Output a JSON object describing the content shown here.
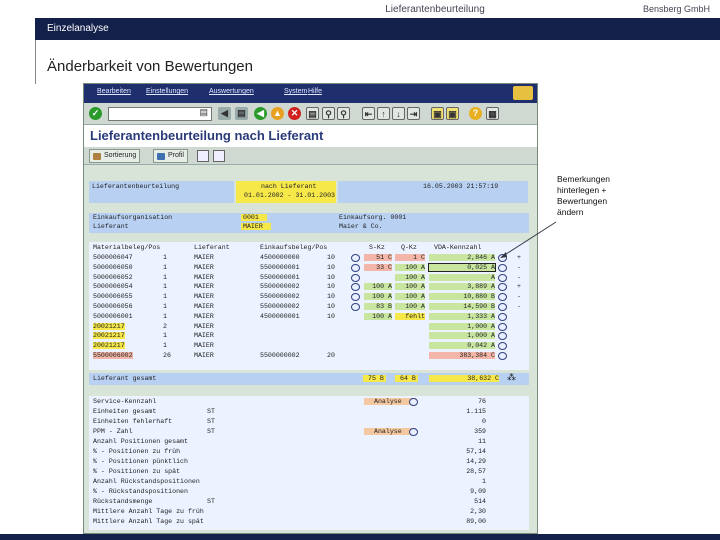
{
  "header": {
    "title": "Lieferantenbeurteilung",
    "company": "Bensberg GmbH",
    "section": "Einzelanalyse"
  },
  "slide_title": "Änderbarkeit von Bewertungen",
  "annotation": [
    "Bemerkungen",
    "hinterlegen +",
    "Bewertungen",
    "ändern"
  ],
  "sap": {
    "menu": [
      "Bearbeiten",
      "Einstellungen",
      "Auswertungen",
      "System",
      "Hilfe"
    ],
    "command_field_value": "",
    "title": "Lieferantenbeurteilung nach Lieferant",
    "app_buttons": [
      "Sortierung",
      "Profil"
    ],
    "info": {
      "label": "Lieferantenbeurteilung",
      "mode": "nach Lieferant",
      "period": "01.01.2002 - 31.01.2003",
      "timestamp": "16.05.2003 21:57:19"
    },
    "org": {
      "ek_org_label": "Einkaufsorganisation",
      "ek_org_value": "0001",
      "ek_org_text": "Einkaufsorg. 0001",
      "lieferant_label": "Lieferant",
      "lieferant_value": "MAIER",
      "lieferant_text": "Maier & Co."
    },
    "table": {
      "columns": [
        "Materialbeleg/Pos",
        "Lieferant",
        "Einkaufsbeleg/Pos",
        "S-Kz",
        "Q-Kz",
        "VDA-Kennzahl"
      ],
      "rows": [
        {
          "mb": "5000006047",
          "pos": "1",
          "lief": "MAIER",
          "eb": "4500000000",
          "ebpos": "10",
          "skz": "51 C",
          "qkz": "1 C",
          "vda": "2,846 A",
          "sign": "+"
        },
        {
          "mb": "5000006050",
          "pos": "1",
          "lief": "MAIER",
          "eb": "5500000001",
          "ebpos": "10",
          "skz": "33 C",
          "qkz": "100 A",
          "vda": "0,025 A",
          "sign": "-"
        },
        {
          "mb": "5000006052",
          "pos": "1",
          "lief": "MAIER",
          "eb": "5500000001",
          "ebpos": "10",
          "skz": "",
          "qkz": "100 A",
          "vda": "A",
          "sign": "-"
        },
        {
          "mb": "5000006054",
          "pos": "1",
          "lief": "MAIER",
          "eb": "5500000002",
          "ebpos": "10",
          "skz": "100 A",
          "qkz": "100 A",
          "vda": "3,889 A",
          "sign": "+"
        },
        {
          "mb": "5000006055",
          "pos": "1",
          "lief": "MAIER",
          "eb": "5500000002",
          "ebpos": "10",
          "skz": "100 A",
          "qkz": "100 A",
          "vda": "10,880 B",
          "sign": "-"
        },
        {
          "mb": "5000006056",
          "pos": "1",
          "lief": "MAIER",
          "eb": "5500000002",
          "ebpos": "10",
          "skz": "83 B",
          "qkz": "100 A",
          "vda": "14,590 B",
          "sign": "-"
        },
        {
          "mb": "5000006001",
          "pos": "1",
          "lief": "MAIER",
          "eb": "4500000001",
          "ebpos": "10",
          "skz": "100 A",
          "qkz": "fehlt",
          "vda": "1,333 A",
          "sign": ""
        },
        {
          "mb": "20021217",
          "pos": "2",
          "lief": "MAIER",
          "eb": "",
          "ebpos": "",
          "skz": "",
          "qkz": "",
          "vda": "1,000 A",
          "sign": ""
        },
        {
          "mb": "20021217",
          "pos": "1",
          "lief": "MAIER",
          "eb": "",
          "ebpos": "",
          "skz": "",
          "qkz": "",
          "vda": "1,000 A",
          "sign": ""
        },
        {
          "mb": "20021217",
          "pos": "1",
          "lief": "MAIER",
          "eb": "",
          "ebpos": "",
          "skz": "",
          "qkz": "",
          "vda": "0,042 A",
          "sign": ""
        },
        {
          "mb": "5500006002",
          "pos": "26",
          "lief": "MAIER",
          "eb": "5500000002",
          "ebpos": "20",
          "skz": "",
          "qkz": "",
          "vda": "383,384 C",
          "sign": ""
        }
      ],
      "total": {
        "label": "Lieferant gesamt",
        "skz": "75 B",
        "qkz": "64 B",
        "vda": "38,632 C"
      }
    },
    "kennzahlen": [
      {
        "label": "Service-Kennzahl",
        "unit": "",
        "btn": "Analyse",
        "value": "76"
      },
      {
        "label": "Einheiten gesamt",
        "unit": "ST",
        "btn": "",
        "value": "1.115"
      },
      {
        "label": "Einheiten fehlerhaft",
        "unit": "ST",
        "btn": "",
        "value": "0"
      },
      {
        "label": "PPM - Zahl",
        "unit": "ST",
        "btn": "Analyse",
        "value": "359"
      },
      {
        "label": "Anzahl Positionen gesamt",
        "unit": "",
        "btn": "",
        "value": "11"
      },
      {
        "label": "% - Positionen zu früh",
        "unit": "",
        "btn": "",
        "value": "57,14"
      },
      {
        "label": "% - Positionen pünktlich",
        "unit": "",
        "btn": "",
        "value": "14,29"
      },
      {
        "label": "% - Positionen zu spät",
        "unit": "",
        "btn": "",
        "value": "28,57"
      },
      {
        "label": "Anzahl Rückstandspositionen",
        "unit": "",
        "btn": "",
        "value": "1"
      },
      {
        "label": "% - Rückstandspositionen",
        "unit": "",
        "btn": "",
        "value": "9,09"
      },
      {
        "label": "Rückstandsmenge",
        "unit": "ST",
        "btn": "",
        "value": "514"
      },
      {
        "label": "Mittlere Anzahl Tage zu früh",
        "unit": "",
        "btn": "",
        "value": "2,30"
      },
      {
        "label": "Mittlere Anzahl Tage zu spät",
        "unit": "",
        "btn": "",
        "value": "89,00"
      }
    ]
  }
}
